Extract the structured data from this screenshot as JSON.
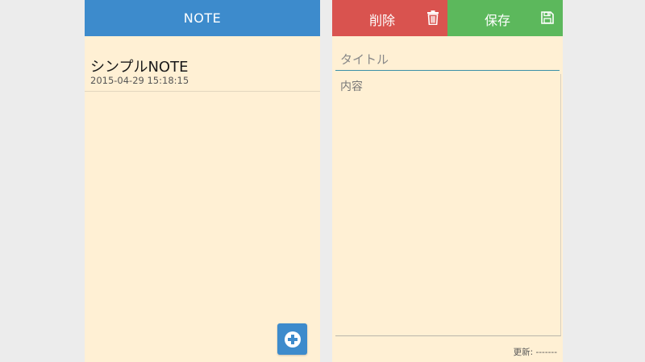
{
  "list_screen": {
    "header_title": "NOTE",
    "notes": [
      {
        "title": "シンプルNOTE",
        "date": "2015-04-29 15:18:15"
      }
    ],
    "add_button_icon": "plus-circle-icon",
    "colors": {
      "header": "#3d8bcc",
      "background": "#fff0d4"
    }
  },
  "edit_screen": {
    "delete_button": {
      "label": "削除",
      "icon": "trash-icon"
    },
    "save_button": {
      "label": "保存",
      "icon": "floppy-disk-icon"
    },
    "title_field": {
      "placeholder": "タイトル",
      "value": ""
    },
    "content_field": {
      "placeholder": "内容",
      "value": ""
    },
    "updated_text": "更新: -------",
    "colors": {
      "delete": "#d9534f",
      "save": "#5cb85c",
      "background": "#fff0d4"
    }
  }
}
